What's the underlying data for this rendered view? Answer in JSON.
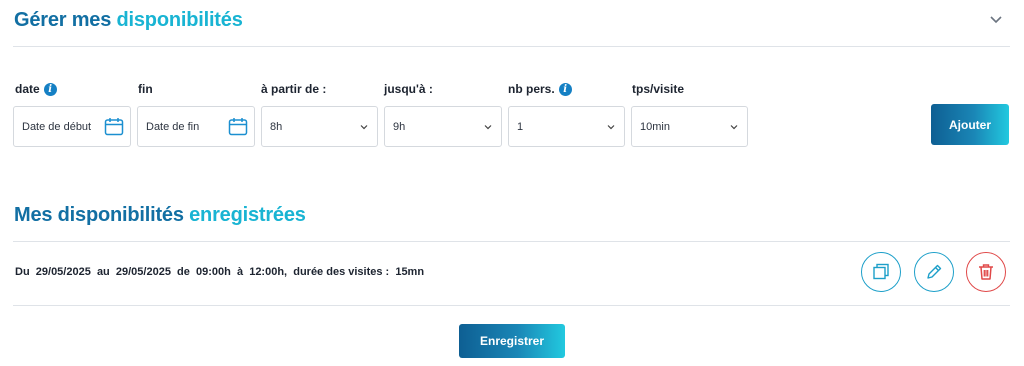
{
  "header": {
    "title_part1": "Gérer mes",
    "title_part2": "disponibilités"
  },
  "form": {
    "labels": {
      "date": "date",
      "fin": "fin",
      "a_partir_de": "à partir de :",
      "jusqua": "jusqu'à :",
      "nb_pers": "nb pers.",
      "tps_visite": "tps/visite"
    },
    "start_date_placeholder": "Date de début",
    "end_date_placeholder": "Date de fin",
    "from_value": "8h",
    "to_value": "9h",
    "persons_value": "1",
    "visit_time_value": "10min",
    "add_label": "Ajouter"
  },
  "saved": {
    "title_part1": "Mes disponibilités",
    "title_part2": "enregistrées",
    "entry_text": "Du  29/05/2025  au  29/05/2025  de  09:00h  à  12:00h,  durée des visites :  15mn"
  },
  "footer": {
    "save_label": "Enregistrer"
  },
  "colors": {
    "title_dark": "#126fa3",
    "title_light": "#19b4d3",
    "action_blue": "#1c9fc9",
    "delete_red": "#e04848"
  },
  "icons": {
    "collapse": "chevron-down-icon",
    "calendar": "calendar-icon",
    "info": "info-icon",
    "copy": "copy-icon",
    "edit": "pencil-icon",
    "delete": "trash-icon"
  }
}
